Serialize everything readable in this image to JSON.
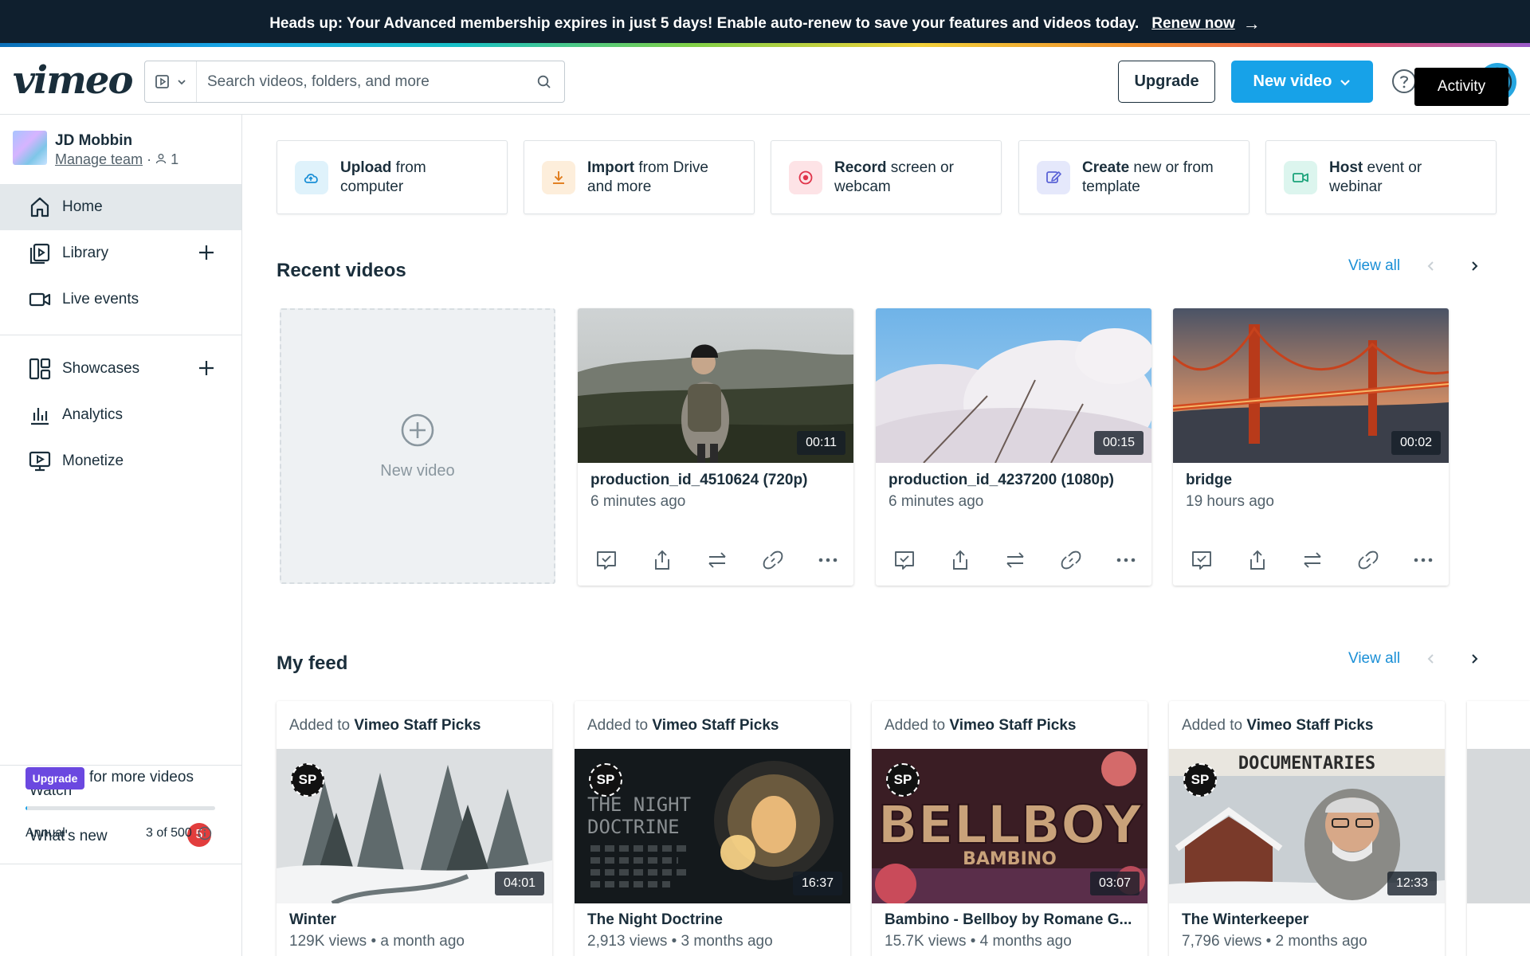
{
  "banner": {
    "message": "Heads up: Your Advanced membership expires in just 5 days! Enable auto-renew to save your features and videos today.",
    "link": "Renew now"
  },
  "header": {
    "logo": "vimeo",
    "search_placeholder": "Search videos, folders, and more",
    "upgrade_label": "Upgrade",
    "new_video_label": "New video",
    "tooltip": "Activity"
  },
  "sidebar": {
    "team_name": "JD Mobbin",
    "manage_team": "Manage team",
    "member_count": "1",
    "nav": [
      {
        "label": "Home",
        "icon": "home-icon"
      },
      {
        "label": "Library",
        "icon": "library-icon"
      },
      {
        "label": "Live events",
        "icon": "camera-icon"
      },
      {
        "label": "Showcases",
        "icon": "showcase-icon"
      },
      {
        "label": "Analytics",
        "icon": "analytics-icon"
      },
      {
        "label": "Monetize",
        "icon": "monetize-icon"
      }
    ],
    "watch": "Watch",
    "whats_new": "What's new",
    "whats_new_badge": "5",
    "upgrade_pill": "Upgrade",
    "upgrade_text": "for more videos",
    "plan_label": "Annual",
    "plan_count": "3 of 500",
    "plan_used_fraction": 0.006
  },
  "quick_actions": [
    {
      "bold": "Upload",
      "rest_1": " from",
      "rest_2": "computer",
      "icon": "cloud-upload-icon",
      "bg": "#dff2fb",
      "fg": "#1a8fd6"
    },
    {
      "bold": "Import",
      "rest_1": " from Drive",
      "rest_2": "and more",
      "icon": "download-icon",
      "bg": "#fdeedb",
      "fg": "#e07b1a"
    },
    {
      "bold": "Record",
      "rest_1": " screen or",
      "rest_2": "webcam",
      "icon": "record-icon",
      "bg": "#fde3e6",
      "fg": "#e0344a"
    },
    {
      "bold": "Create",
      "rest_1": " new or from",
      "rest_2": "template",
      "icon": "edit-icon",
      "bg": "#e5e8fb",
      "fg": "#5b63d6"
    },
    {
      "bold": "Host",
      "rest_1": " event or",
      "rest_2": "webinar",
      "icon": "video-camera-icon",
      "bg": "#dcf5ee",
      "fg": "#1aa37a"
    }
  ],
  "recent": {
    "title": "Recent videos",
    "view_all": "View all",
    "new_video": "New video",
    "videos": [
      {
        "title": "production_id_4510624 (720p)",
        "time": "6 minutes ago",
        "duration": "00:11"
      },
      {
        "title": "production_id_4237200 (1080p)",
        "time": "6 minutes ago",
        "duration": "00:15"
      },
      {
        "title": "bridge",
        "time": "19 hours ago",
        "duration": "00:02"
      }
    ]
  },
  "feed": {
    "title": "My feed",
    "view_all": "View all",
    "added_to": "Added to",
    "channel": "Vimeo Staff Picks",
    "sp_label": "SP",
    "items": [
      {
        "title": "Winter",
        "meta": "129K views • a month ago",
        "duration": "04:01"
      },
      {
        "title": "The Night Doctrine",
        "meta": "2,913 views • 3 months ago",
        "duration": "16:37",
        "poster_text_1": "THE NIGHT",
        "poster_text_2": "DOCTRINE"
      },
      {
        "title": "Bambino - Bellboy by Romane G...",
        "meta": "15.7K views • 4 months ago",
        "duration": "03:07",
        "poster_text_1": "BELLBOY",
        "poster_text_2": "BAMBINO"
      },
      {
        "title": "The Winterkeeper",
        "meta": "7,796 views • 2 months ago",
        "duration": "12:33",
        "poster_text_1": "DOCUMENTARIES"
      }
    ]
  }
}
